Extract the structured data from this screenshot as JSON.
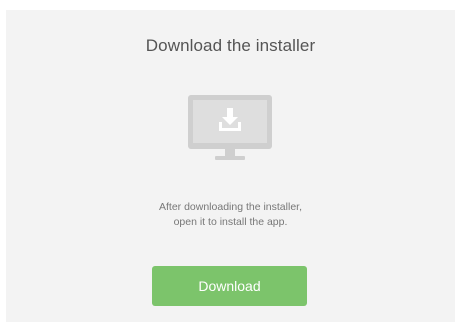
{
  "installer_panel": {
    "title": "Download the installer",
    "icon": "monitor-download-icon",
    "description_lines": [
      "After downloading the installer,",
      "open it to install the app."
    ],
    "download_button_label": "Download",
    "colors": {
      "panel_background": "#f3f3f3",
      "button_background": "#7cc46b",
      "monitor_frame": "#cfcfcf",
      "title_text": "#555555"
    }
  }
}
